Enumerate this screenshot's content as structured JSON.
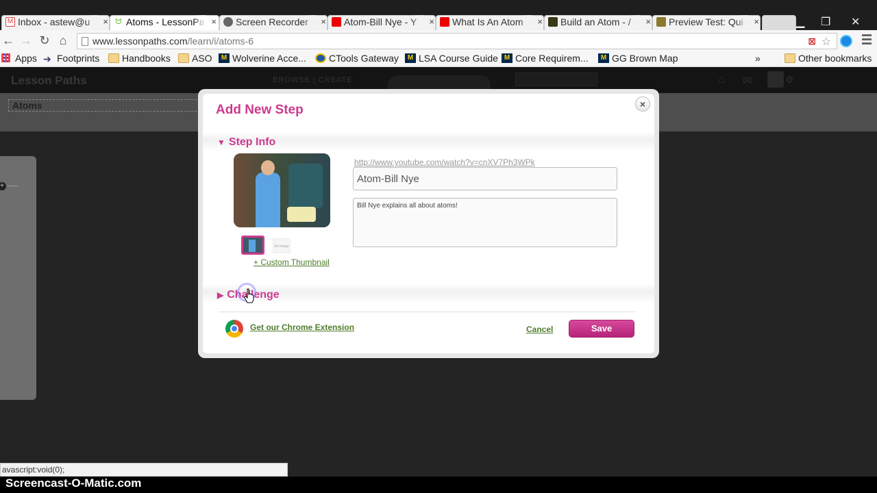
{
  "browser": {
    "tabs": [
      {
        "label": "Inbox - astew@u",
        "icon": "gmail-icon",
        "active": false
      },
      {
        "label": "Atoms - LessonPa",
        "icon": "lessonpaths-icon",
        "active": true
      },
      {
        "label": "Screen Recorder",
        "icon": "screencast-icon",
        "active": false
      },
      {
        "label": "Atom-Bill Nye - Y",
        "icon": "youtube-icon",
        "active": false
      },
      {
        "label": "What Is An Atom",
        "icon": "youtube-icon",
        "active": false
      },
      {
        "label": "Build an Atom - /",
        "icon": "phet-icon",
        "active": false
      },
      {
        "label": "Preview Test: Qui",
        "icon": "quiz-icon",
        "active": false
      }
    ],
    "url": {
      "host": "www.lessonpaths.com",
      "path": "/learn/i/atoms-6"
    },
    "bookmarks": [
      {
        "label": "Apps",
        "icon": "apps-grid-icon"
      },
      {
        "label": "Footprints",
        "icon": "arrow-icon"
      },
      {
        "label": "Handbooks",
        "icon": "folder-icon"
      },
      {
        "label": "ASO",
        "icon": "folder-icon"
      },
      {
        "label": "Wolverine Acce...",
        "icon": "umich-icon"
      },
      {
        "label": "CTools Gateway",
        "icon": "ctools-icon"
      },
      {
        "label": "LSA Course Guide",
        "icon": "umich-icon"
      },
      {
        "label": "Core Requirem...",
        "icon": "umich-icon"
      },
      {
        "label": "GG Brown Map",
        "icon": "umich-icon"
      }
    ],
    "bookmarks_overflow": "»",
    "other_bookmarks": "Other bookmarks",
    "status_text": "avascript:void(0);"
  },
  "site": {
    "logo": "Lesson Paths",
    "nav": "BROWSE  |  CREATE",
    "path_title": "Atoms"
  },
  "dialog": {
    "title": "Add New Step",
    "close_glyph": "×",
    "step_info_label": "Step Info",
    "video_url": "http://www.youtube.com/watch?v=cnXV7Ph3WPk",
    "title_value": "Atom-Bill Nye",
    "description_value": "Bill Nye explains all about atoms!",
    "no_image_label": "No Image",
    "custom_thumbnail": "+ Custom Thumbnail",
    "challenge_label": "Challenge",
    "chrome_extension": "Get our Chrome Extension",
    "cancel": "Cancel",
    "save": "Save"
  },
  "watermark": "Screencast-O-Matic.com",
  "colors": {
    "accent": "#cc3a8e",
    "link_green": "#4f7c2a"
  }
}
